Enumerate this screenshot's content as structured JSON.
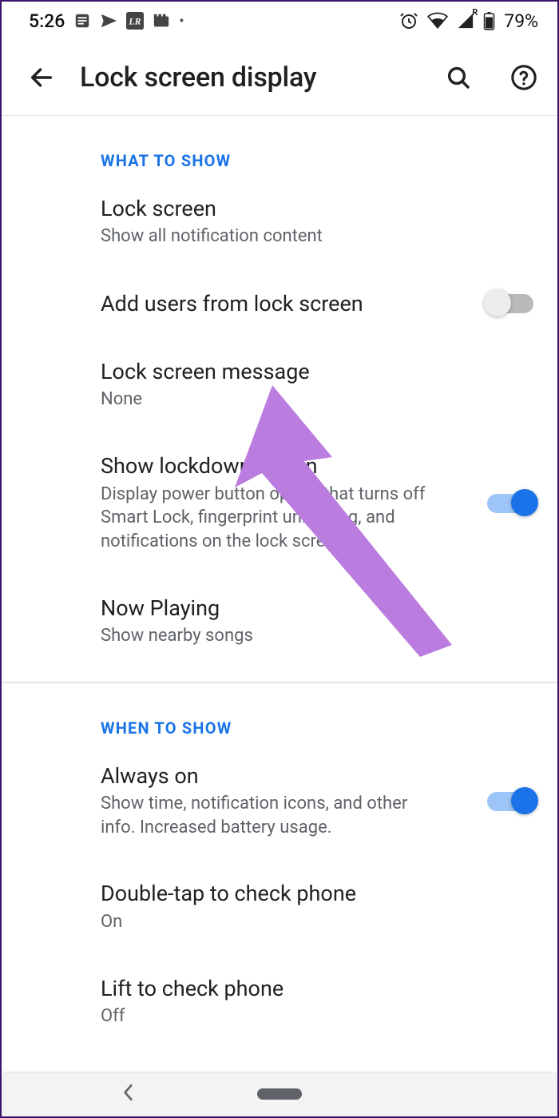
{
  "status_bar": {
    "time": "5:26",
    "battery_text": "79%"
  },
  "header": {
    "title": "Lock screen display"
  },
  "sections": [
    {
      "header": "What to show",
      "items": [
        {
          "title": "Lock screen",
          "subtitle": "Show all notification content"
        },
        {
          "title": "Add users from lock screen",
          "subtitle": "",
          "toggle": "off"
        },
        {
          "title": "Lock screen message",
          "subtitle": "None"
        },
        {
          "title": "Show lockdown option",
          "subtitle": "Display power button option that turns off Smart Lock, fingerprint unlocking, and notifications on the lock screen",
          "toggle": "on"
        },
        {
          "title": "Now Playing",
          "subtitle": "Show nearby songs"
        }
      ]
    },
    {
      "header": "When to show",
      "items": [
        {
          "title": "Always on",
          "subtitle": "Show time, notification icons, and other info. Increased battery usage.",
          "toggle": "on"
        },
        {
          "title": "Double-tap to check phone",
          "subtitle": "On"
        },
        {
          "title": "Lift to check phone",
          "subtitle": "Off"
        }
      ]
    }
  ]
}
